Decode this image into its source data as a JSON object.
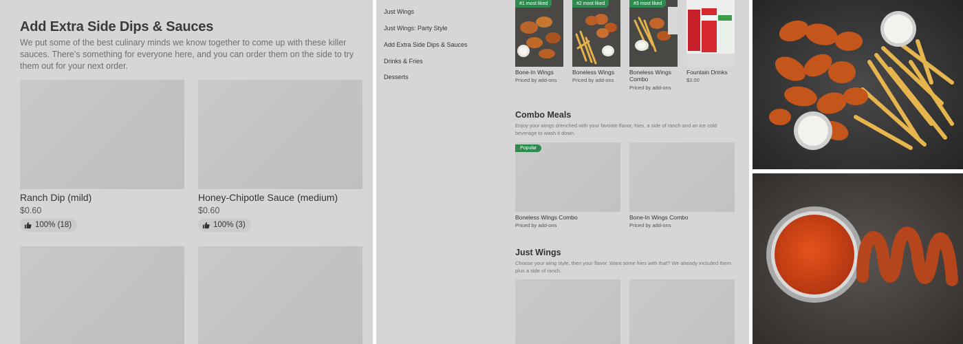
{
  "left_panel": {
    "title": "Add Extra Side Dips & Sauces",
    "description": "We put some of the best culinary minds we know together to come up with these killer sauces. There's something for everyone here, and you can order them on the side to try them out for your next order.",
    "items": [
      {
        "name": "Ranch Dip (mild)",
        "price": "$0.60",
        "rating": "100% (18)"
      },
      {
        "name": "Honey-Chipotle Sauce (medium)",
        "price": "$0.60",
        "rating": "100% (3)"
      }
    ]
  },
  "middle_panel": {
    "nav": [
      "Just Wings",
      "Just Wings: Party Style",
      "Add Extra Side Dips & Sauces",
      "Drinks & Fries",
      "Desserts"
    ],
    "top_items": [
      {
        "badge": "#1 most liked",
        "name": "Bone-In Wings",
        "sub": "Priced by add-ons"
      },
      {
        "badge": "#2 most liked",
        "name": "Boneless Wings",
        "sub": "Priced by add-ons"
      },
      {
        "badge": "#3 most liked",
        "name": "Boneless Wings Combo",
        "sub": "Priced by add-ons"
      },
      {
        "badge": "",
        "name": "Fountain Drinks",
        "sub": "$3.00"
      }
    ],
    "combo": {
      "title": "Combo Meals",
      "description": "Enjoy your wings drenched with your favorite flavor, fries, a side of ranch and an ice cold beverage to wash it down.",
      "badge": "Popular",
      "items": [
        {
          "name": "Boneless Wings Combo",
          "sub": "Priced by add-ons"
        },
        {
          "name": "Bone-In Wings Combo",
          "sub": "Priced by add-ons"
        }
      ]
    },
    "just_wings": {
      "title": "Just Wings",
      "description": "Choose your wing style, then your flavor. Want some fries with that? We already included them plus a side of ranch."
    }
  },
  "colors": {
    "panel_bg": "#d6d6d6",
    "badge_green": "#2f8a4f"
  }
}
